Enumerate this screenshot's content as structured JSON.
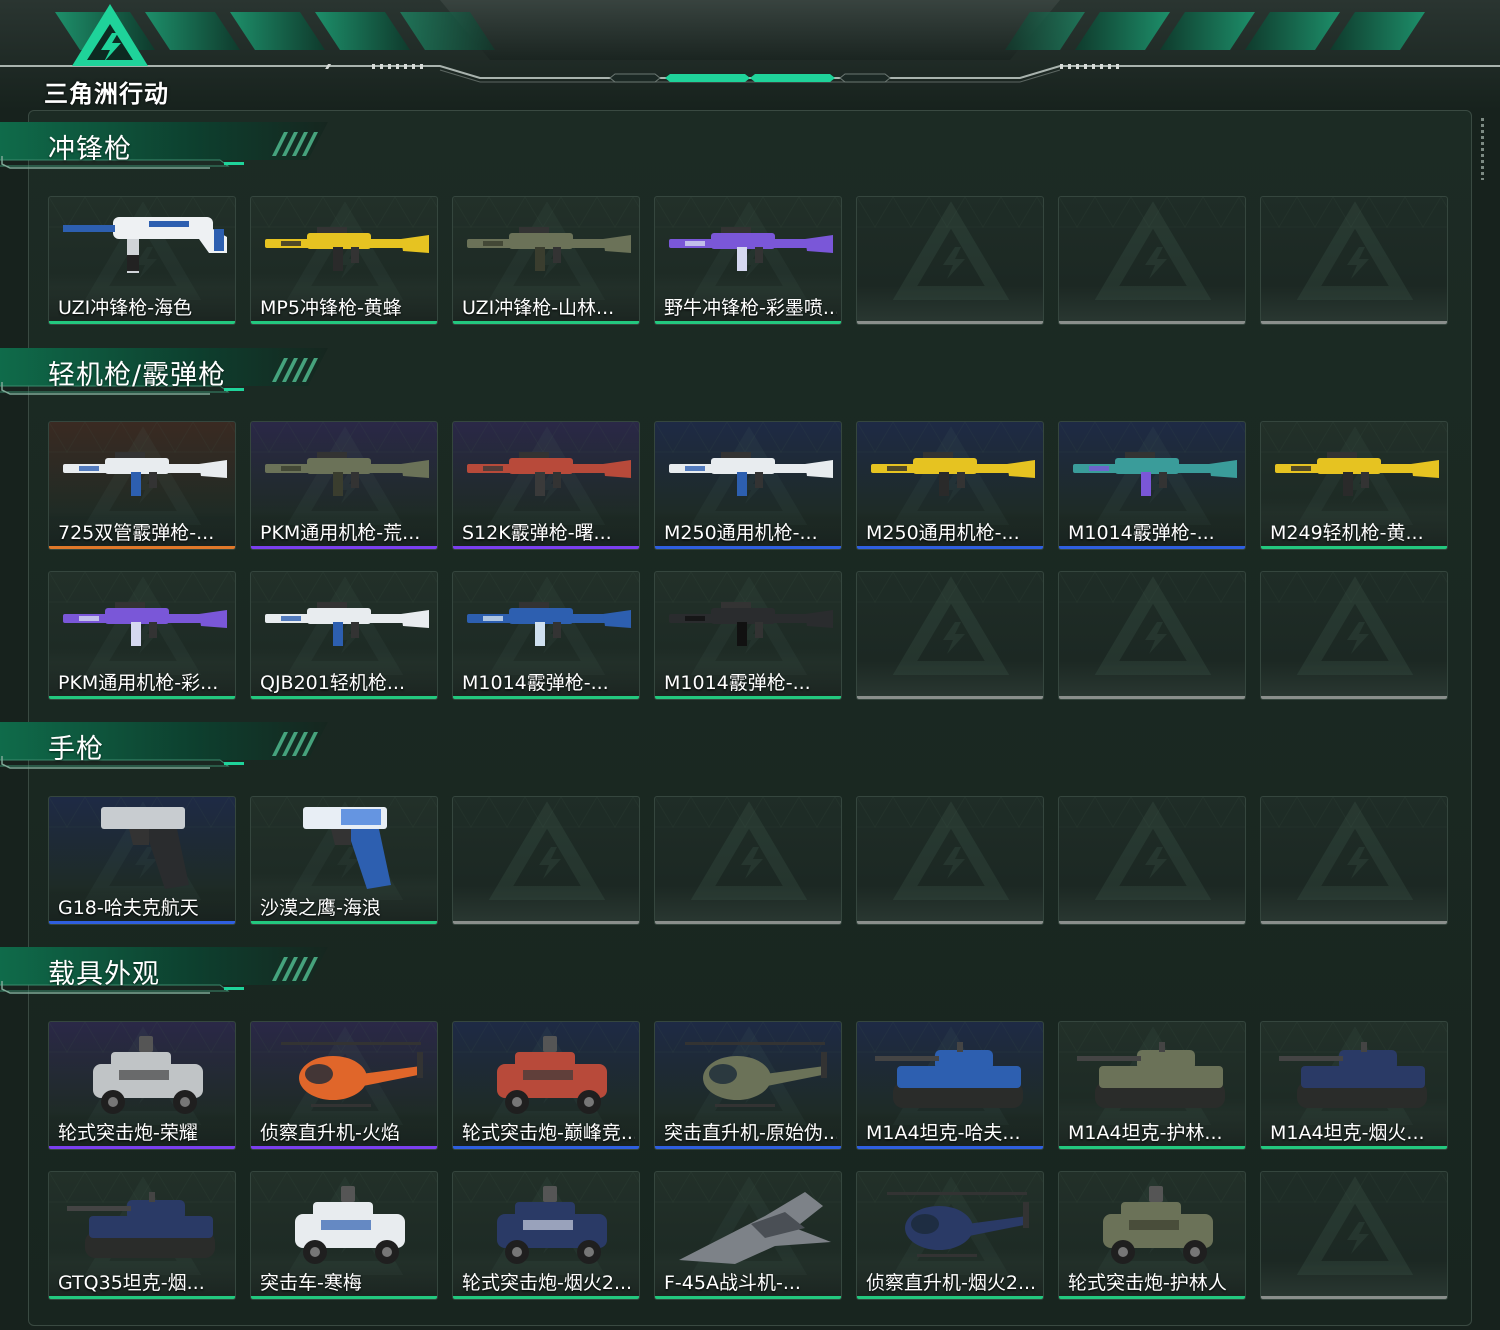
{
  "header": {
    "logo_text": "三角洲行动"
  },
  "colors": {
    "accent": "#1fd39a",
    "rarity_gold": "#e0782a",
    "rarity_purple": "#7b3ff0",
    "rarity_blue": "#2f5fe0",
    "rarity_green": "#23c87f",
    "empty": "#8a8f8c",
    "tint_purple": "#2a2847",
    "tint_blue": "#1e2a45",
    "tint_orange": "#3a2a22"
  },
  "sections": [
    {
      "title": "冲锋枪",
      "rows": [
        [
          {
            "label": "UZI冲锋枪-海色",
            "rarity": "green",
            "icon": "uzi-smg-white-blue-icon"
          },
          {
            "label": "MP5冲锋枪-黄蜂",
            "rarity": "green",
            "icon": "mp5-smg-yellow-icon"
          },
          {
            "label": "UZI冲锋枪-山林...",
            "rarity": "green",
            "icon": "uzi-smg-camo-icon"
          },
          {
            "label": "野牛冲锋枪-彩墨喷...",
            "rarity": "green",
            "icon": "bizon-smg-purple-icon"
          },
          null,
          null,
          null
        ]
      ]
    },
    {
      "title": "轻机枪/霰弹枪",
      "rows": [
        [
          {
            "label": "725双管霰弹枪-...",
            "rarity": "gold",
            "icon": "725-shotgun-white-icon"
          },
          {
            "label": "PKM通用机枪-荒...",
            "rarity": "purple",
            "icon": "pkm-lmg-desert-icon"
          },
          {
            "label": "S12K霰弹枪-曙...",
            "rarity": "purple",
            "icon": "s12k-shotgun-red-icon"
          },
          {
            "label": "M250通用机枪-...",
            "rarity": "blue",
            "icon": "m250-lmg-purple-white-icon"
          },
          {
            "label": "M250通用机枪-...",
            "rarity": "blue",
            "icon": "m250-lmg-yellow-icon"
          },
          {
            "label": "M1014霰弹枪-...",
            "rarity": "blue",
            "icon": "m1014-shotgun-teal-icon"
          },
          {
            "label": "M249轻机枪-黄...",
            "rarity": "green",
            "icon": "m249-lmg-yellow-icon"
          }
        ],
        [
          {
            "label": "PKM通用机枪-彩...",
            "rarity": "green",
            "icon": "pkm-lmg-purple-icon"
          },
          {
            "label": "QJB201轻机枪...",
            "rarity": "green",
            "icon": "qjb201-lmg-white-icon"
          },
          {
            "label": "M1014霰弹枪-...",
            "rarity": "green",
            "icon": "m1014-shotgun-blue-icon"
          },
          {
            "label": "M1014霰弹枪-...",
            "rarity": "green",
            "icon": "m1014-shotgun-black-icon"
          },
          null,
          null,
          null
        ]
      ]
    },
    {
      "title": "手枪",
      "rows": [
        [
          {
            "label": "G18-哈夫克航天",
            "rarity": "blue",
            "icon": "g18-pistol-icon"
          },
          {
            "label": "沙漠之鹰-海浪",
            "rarity": "green",
            "icon": "desert-eagle-pistol-icon"
          },
          null,
          null,
          null,
          null,
          null
        ]
      ]
    },
    {
      "title": "载具外观",
      "rows": [
        [
          {
            "label": "轮式突击炮-荣耀",
            "rarity": "purple",
            "icon": "wheeled-assault-gun-silver-icon"
          },
          {
            "label": "侦察直升机-火焰",
            "rarity": "purple",
            "icon": "scout-helicopter-flame-icon"
          },
          {
            "label": "轮式突击炮-巅峰竞...",
            "rarity": "blue",
            "icon": "wheeled-assault-gun-red-icon"
          },
          {
            "label": "突击直升机-原始伪...",
            "rarity": "blue",
            "icon": "attack-helicopter-camo-icon"
          },
          {
            "label": "M1A4坦克-哈夫...",
            "rarity": "blue",
            "icon": "m1a4-tank-blue-icon"
          },
          {
            "label": "M1A4坦克-护林...",
            "rarity": "green",
            "icon": "m1a4-tank-forest-icon"
          },
          {
            "label": "M1A4坦克-烟火...",
            "rarity": "green",
            "icon": "m1a4-tank-navy-icon"
          }
        ],
        [
          {
            "label": "GTQ35坦克-烟...",
            "rarity": "green",
            "icon": "gtq35-tank-navy-icon"
          },
          {
            "label": "突击车-寒梅",
            "rarity": "green",
            "icon": "assault-vehicle-white-icon"
          },
          {
            "label": "轮式突击炮-烟火2...",
            "rarity": "green",
            "icon": "wheeled-assault-gun-navy-icon"
          },
          {
            "label": "F-45A战斗机-...",
            "rarity": "green",
            "icon": "f45a-fighter-jet-icon"
          },
          {
            "label": "侦察直升机-烟火2...",
            "rarity": "green",
            "icon": "scout-helicopter-navy-icon"
          },
          {
            "label": "轮式突击炮-护林人",
            "rarity": "green",
            "icon": "wheeled-assault-gun-camo-icon"
          },
          null
        ]
      ]
    }
  ]
}
